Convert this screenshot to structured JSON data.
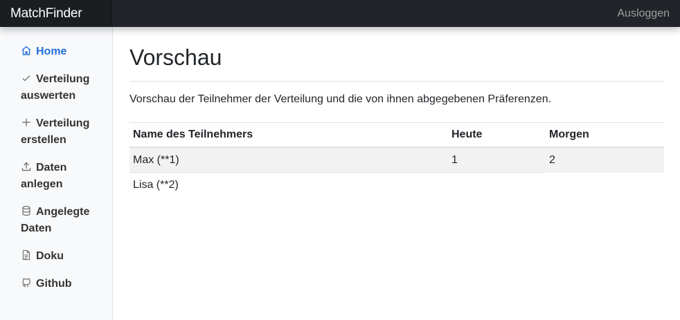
{
  "app": {
    "brand": "MatchFinder",
    "logout_label": "Ausloggen"
  },
  "sidebar": {
    "items": [
      {
        "label": "Home",
        "icon": "home-icon",
        "active": true
      },
      {
        "label": "Verteilung auswerten",
        "icon": "check-icon"
      },
      {
        "label": "Verteilung erstellen",
        "icon": "plus-icon"
      },
      {
        "label": "Daten anlegen",
        "icon": "upload-icon"
      },
      {
        "label": "Angelegte Daten",
        "icon": "database-icon"
      },
      {
        "label": "Doku",
        "icon": "file-text-icon"
      },
      {
        "label": "Github",
        "icon": "github-icon"
      }
    ]
  },
  "main": {
    "title": "Vorschau",
    "description": "Vorschau der Teilnehmer der Verteilung und die von ihnen abgegebenen Präferenzen.",
    "table": {
      "headers": [
        "Name des Teilnehmers",
        "Heute",
        "Morgen"
      ],
      "rows": [
        [
          "Max (**1)",
          "1",
          "2"
        ],
        [
          "Lisa (**2)",
          "",
          ""
        ]
      ]
    }
  },
  "colors": {
    "accent": "#2470dc",
    "topbar": "#212529",
    "sidebar_bg": "#f8f9fa"
  }
}
